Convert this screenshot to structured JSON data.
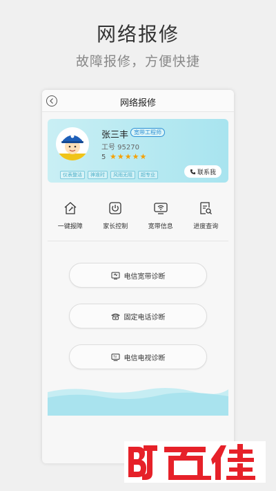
{
  "promo": {
    "title": "网络报修",
    "subtitle": "故障报修，方便快捷"
  },
  "topbar": {
    "title": "网络报修",
    "back_icon": "chevron-left-icon"
  },
  "engineer": {
    "name": "张三丰",
    "badge": "宽带工程师",
    "work_no": "工号 95270",
    "rating": "5",
    "stars": "★★★★★",
    "contact_label": "联系我",
    "tags": [
      "仪表整洁",
      "神准时",
      "风雨无阻",
      "超专业"
    ]
  },
  "menu": [
    {
      "label": "一键报障",
      "icon": "house-wrench-icon"
    },
    {
      "label": "家长控制",
      "icon": "power-icon"
    },
    {
      "label": "宽带信息",
      "icon": "wifi-monitor-icon"
    },
    {
      "label": "进度查询",
      "icon": "document-search-icon"
    }
  ],
  "diagnostics": [
    {
      "label": "电信宽带诊断",
      "icon": "broadband-icon"
    },
    {
      "label": "固定电话诊断",
      "icon": "telephone-icon"
    },
    {
      "label": "电信电视诊断",
      "icon": "tv-icon"
    }
  ],
  "colors": {
    "card_gradient_start": "#c9eff4",
    "card_gradient_end": "#a8e4ef",
    "star": "#f5a000",
    "badge": "#2b8fd4",
    "logo_red": "#e62129"
  },
  "watermark": "百佳"
}
